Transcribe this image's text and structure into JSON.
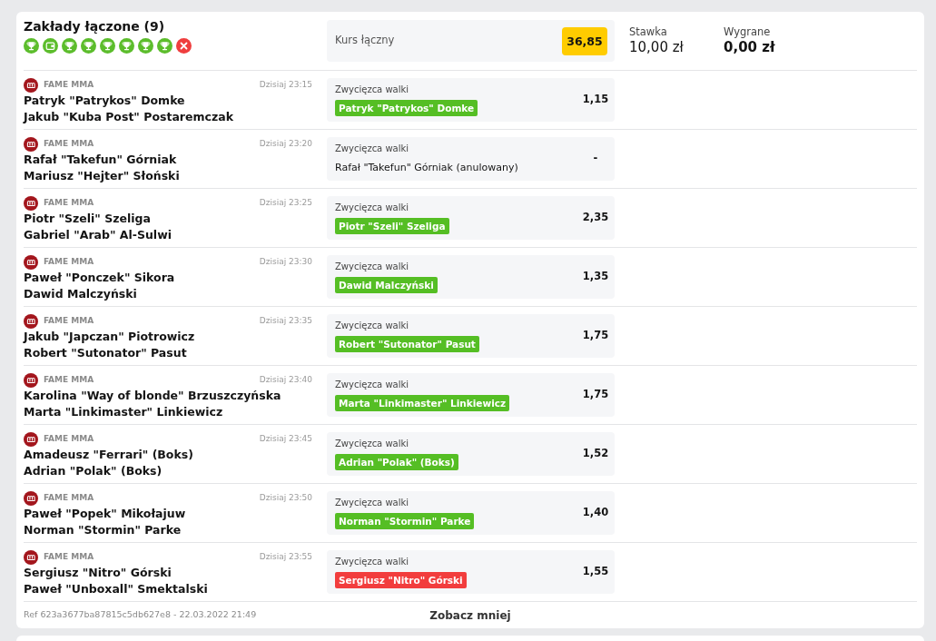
{
  "bet": {
    "title": "Zakłady łączone (9)",
    "results": [
      {
        "kind": "won"
      },
      {
        "kind": "void"
      },
      {
        "kind": "won"
      },
      {
        "kind": "won"
      },
      {
        "kind": "won"
      },
      {
        "kind": "won"
      },
      {
        "kind": "won"
      },
      {
        "kind": "won"
      },
      {
        "kind": "lost"
      }
    ],
    "total_odds": {
      "label": "Kurs łączny",
      "value": "36,85"
    },
    "stake": {
      "label": "Stawka",
      "value": "10,00 zł"
    },
    "winnings": {
      "label": "Wygrane",
      "value": "0,00 zł"
    }
  },
  "fights": [
    {
      "league": "FAME MMA",
      "time": "Dzisiaj 23:15",
      "fighters": [
        "Patryk \"Patrykos\" Domke",
        "Jakub \"Kuba Post\" Postaremczak"
      ],
      "market": "Zwycięzca walki",
      "pick": "Patryk \"Patrykos\" Domke",
      "kind": "won",
      "odds": "1,15"
    },
    {
      "league": "FAME MMA",
      "time": "Dzisiaj 23:20",
      "fighters": [
        "Rafał \"Takefun\" Górniak",
        "Mariusz \"Hejter\" Słoński"
      ],
      "market": "Zwycięzca walki",
      "pick": "Rafał \"Takefun\" Górniak (anulowany)",
      "kind": "void",
      "odds": "-"
    },
    {
      "league": "FAME MMA",
      "time": "Dzisiaj 23:25",
      "fighters": [
        "Piotr \"Szeli\" Szeliga",
        "Gabriel \"Arab\" Al-Sulwi"
      ],
      "market": "Zwycięzca walki",
      "pick": "Piotr \"Szeli\" Szeliga",
      "kind": "won",
      "odds": "2,35"
    },
    {
      "league": "FAME MMA",
      "time": "Dzisiaj 23:30",
      "fighters": [
        "Paweł \"Ponczek\" Sikora",
        "Dawid Malczyński"
      ],
      "market": "Zwycięzca walki",
      "pick": "Dawid Malczyński",
      "kind": "won",
      "odds": "1,35"
    },
    {
      "league": "FAME MMA",
      "time": "Dzisiaj 23:35",
      "fighters": [
        "Jakub \"Japczan\" Piotrowicz",
        "Robert \"Sutonator\" Pasut"
      ],
      "market": "Zwycięzca walki",
      "pick": "Robert \"Sutonator\" Pasut",
      "kind": "won",
      "odds": "1,75"
    },
    {
      "league": "FAME MMA",
      "time": "Dzisiaj 23:40",
      "fighters": [
        "Karolina \"Way of blonde\" Brzuszczyńska",
        "Marta \"Linkimaster\" Linkiewicz"
      ],
      "market": "Zwycięzca walki",
      "pick": "Marta \"Linkimaster\" Linkiewicz",
      "kind": "won",
      "odds": "1,75"
    },
    {
      "league": "FAME MMA",
      "time": "Dzisiaj 23:45",
      "fighters": [
        "Amadeusz \"Ferrari\" (Boks)",
        "Adrian \"Polak\" (Boks)"
      ],
      "market": "Zwycięzca walki",
      "pick": "Adrian \"Polak\" (Boks)",
      "kind": "won",
      "odds": "1,52"
    },
    {
      "league": "FAME MMA",
      "time": "Dzisiaj 23:50",
      "fighters": [
        "Paweł \"Popek\" Mikołajuw",
        "Norman \"Stormin\" Parke"
      ],
      "market": "Zwycięzca walki",
      "pick": "Norman \"Stormin\" Parke",
      "kind": "won",
      "odds": "1,40"
    },
    {
      "league": "FAME MMA",
      "time": "Dzisiaj 23:55",
      "fighters": [
        "Sergiusz \"Nitro\" Górski",
        "Paweł \"Unboxall\" Smektalski"
      ],
      "market": "Zwycięzca walki",
      "pick": "Sergiusz \"Nitro\" Górski",
      "kind": "lost",
      "odds": "1,55"
    }
  ],
  "footer": {
    "reference": "Ref 623a3677ba87815c5db627e8 - 22.03.2022 21:49",
    "toggle": "Zobacz mniej"
  }
}
